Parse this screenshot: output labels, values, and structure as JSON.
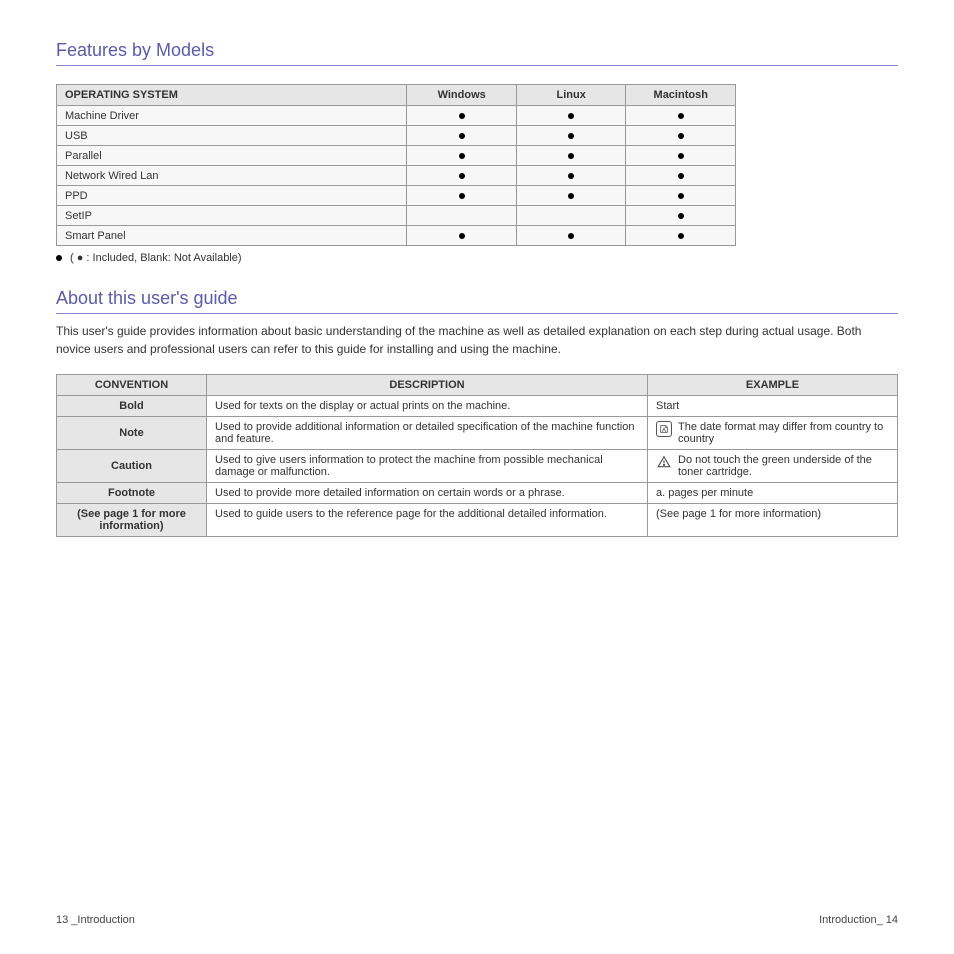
{
  "section1": {
    "title": "Features by Models",
    "table": {
      "headers": [
        "OPERATING SYSTEM",
        "Windows",
        "Linux",
        "Macintosh"
      ],
      "rows": [
        {
          "label": "Machine Driver",
          "marks": [
            true,
            true,
            true
          ]
        },
        {
          "label": "USB",
          "marks": [
            true,
            true,
            true
          ]
        },
        {
          "label": "Parallel",
          "marks": [
            true,
            true,
            true
          ]
        },
        {
          "label": "Network Wired Lan",
          "marks": [
            true,
            true,
            true
          ]
        },
        {
          "label": "PPD",
          "marks": [
            true,
            true,
            true
          ]
        },
        {
          "label": "SetIP",
          "marks": [
            false,
            false,
            true
          ]
        },
        {
          "label": "Smart Panel",
          "marks": [
            true,
            true,
            true
          ]
        }
      ]
    },
    "legend_bullet": "( ● : Included, Blank: Not Available)"
  },
  "section2": {
    "title": "About this user's guide",
    "intro": "This user's guide provides information about basic understanding of the machine as well as detailed explanation on each step during actual usage. Both novice users and professional users can refer to this guide for installing and using the machine.",
    "table": {
      "headers": [
        "CONVENTION",
        "DESCRIPTION",
        "EXAMPLE"
      ],
      "rows": [
        {
          "c1": "Bold",
          "c2": "Used for texts on the display or actual prints on the machine.",
          "c3": "Start",
          "icon": null
        },
        {
          "c1": "Note",
          "c2": "Used to provide additional information or detailed specification of the machine function and feature.",
          "c3": "The date format may differ from country to country",
          "icon": "note"
        },
        {
          "c1": "Caution",
          "c2": "Used to give users information to protect the machine from possible mechanical damage or malfunction.",
          "c3": "Do not touch the green underside of the toner cartridge.",
          "icon": "warn"
        },
        {
          "c1": "Footnote",
          "c2": "Used to provide more detailed information on certain words or a phrase.",
          "c3": "a. pages per minute",
          "icon": null
        },
        {
          "c1": "(See page 1 for more information)",
          "c2": "Used to guide users to the reference page for the additional detailed information.",
          "c3": "(See page 1 for more information)",
          "icon": null
        }
      ]
    }
  },
  "footer": {
    "left": "13 _Introduction",
    "right": "Introduction_ 14"
  }
}
